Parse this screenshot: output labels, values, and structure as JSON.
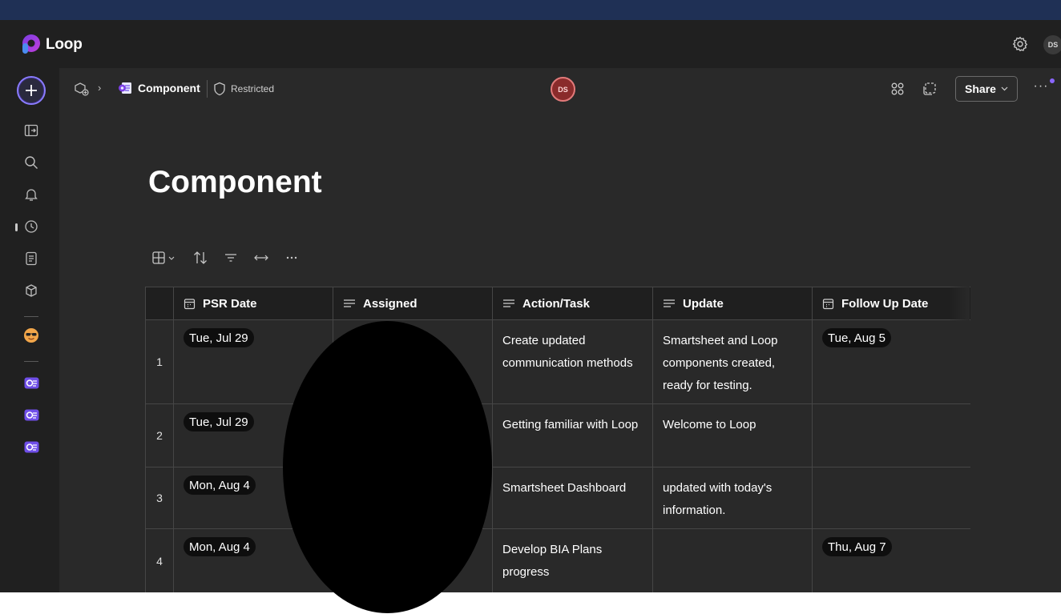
{
  "app": {
    "name": "Loop",
    "user_initials": "DS"
  },
  "breadcrumb": {
    "title": "Component",
    "label": "Restricted"
  },
  "presence": {
    "initials": "DS"
  },
  "toolbar": {
    "share_label": "Share",
    "more": "···"
  },
  "page": {
    "title": "Component"
  },
  "table": {
    "columns": [
      {
        "label": "PSR Date",
        "icon": "calendar-icon"
      },
      {
        "label": "Assigned",
        "icon": "text-lines-icon"
      },
      {
        "label": "Action/Task",
        "icon": "text-lines-icon"
      },
      {
        "label": "Update",
        "icon": "text-lines-icon"
      },
      {
        "label": "Follow Up Date",
        "icon": "calendar-icon"
      }
    ],
    "rows": [
      {
        "index": "1",
        "psr_date": "Tue, Jul 29",
        "action": "Create updated communication methods",
        "update": "Smartsheet and Loop components created, ready for testing.",
        "follow_up": "Tue, Aug 5"
      },
      {
        "index": "2",
        "psr_date": "Tue, Jul 29",
        "action": "Getting familiar with Loop",
        "update": "Welcome to Loop",
        "follow_up": ""
      },
      {
        "index": "3",
        "psr_date": "Mon, Aug 4",
        "action": "Smartsheet Dashboard",
        "update": "updated with today's information.",
        "follow_up": ""
      },
      {
        "index": "4",
        "psr_date": "Mon, Aug 4",
        "action": "Develop BIA Plans progress",
        "update": "",
        "follow_up": "Thu, Aug 7"
      }
    ]
  },
  "colors": {
    "app_bar": "#202020",
    "canvas": "#292929",
    "accent": "#8a7cff",
    "top_stripe": "#1f3055",
    "presence_ring": "#e27a7a"
  }
}
